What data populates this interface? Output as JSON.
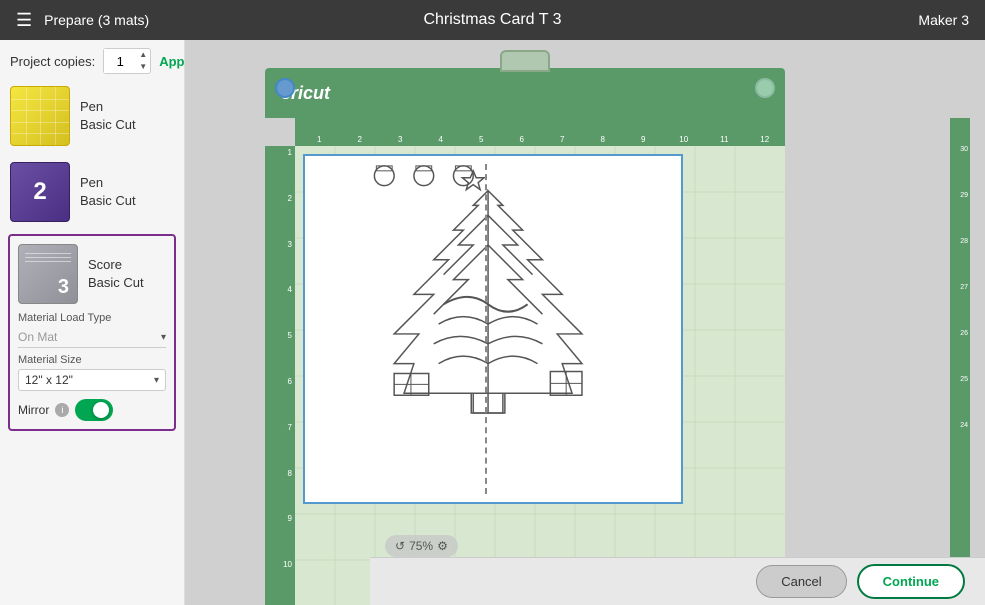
{
  "header": {
    "menu_icon": "☰",
    "title": "Prepare (3 mats)",
    "document_title": "Christmas Card T 3",
    "machine": "Maker 3"
  },
  "left_panel": {
    "project_copies_label": "Project copies:",
    "copies_value": "1",
    "apply_label": "Apply",
    "mat1": {
      "label": "Pen\nBasic Cut",
      "thumb_type": "yellow"
    },
    "mat2": {
      "number": "2",
      "label_line1": "Pen",
      "label_line2": "Basic Cut",
      "thumb_type": "purple"
    },
    "mat3": {
      "number": "3",
      "label_line1": "Score",
      "label_line2": "Basic Cut",
      "thumb_type": "gray"
    },
    "material_load_type_label": "Material Load Type",
    "material_load_value": "On Mat",
    "material_size_label": "Material Size",
    "material_size_value": "12\" x 12\"",
    "mirror_label": "Mirror",
    "toggle_on": true
  },
  "canvas": {
    "cricut_logo": "cricut",
    "zoom_label": "75%",
    "zoom_refresh": "↺"
  },
  "buttons": {
    "cancel": "Cancel",
    "continue": "Continue"
  }
}
